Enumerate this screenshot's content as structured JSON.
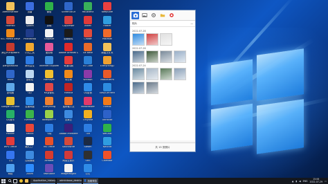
{
  "desktop": {
    "icons": [
      {
        "label": "Administrator",
        "color": "#f2c15a"
      },
      {
        "label": "Foxmail",
        "color": "#d84a3a"
      },
      {
        "label": "VLC media player",
        "color": "#f08a1a"
      },
      {
        "label": "跨云PDF转Word",
        "color": "#c63b2f"
      },
      {
        "label": "pangxiaocao",
        "color": "#4aa0e8"
      },
      {
        "label": "Word",
        "color": "#2f66c9"
      },
      {
        "label": "此电脑",
        "color": "#5fa8e8"
      },
      {
        "label": "Google Chrome",
        "color": "#e8c030"
      },
      {
        "label": "QQ音乐",
        "color": "#27b067"
      },
      {
        "label": "Pointer",
        "color": "#f5f5f5"
      },
      {
        "label": "WPS Office",
        "color": "#e23b3b"
      },
      {
        "label": "飞书",
        "color": "#3575f0"
      },
      {
        "label": "网络",
        "color": "#4ea0f0"
      },
      {
        "label": "迅雷",
        "color": "#3b6ddf"
      },
      {
        "label": "Typora",
        "color": "#eeeeee"
      },
      {
        "label": "Photoshop",
        "color": "#1f3c8a"
      },
      {
        "label": "小丸工具",
        "color": "#f0a830"
      },
      {
        "label": "腾讯会议",
        "color": "#2c7be5"
      },
      {
        "label": "回收站",
        "color": "#bcd7f2"
      },
      {
        "label": "QQ",
        "color": "#f3f3f3"
      },
      {
        "label": "百度网盘",
        "color": "#2f8be8"
      },
      {
        "label": "Evernote",
        "color": "#3bb54a"
      },
      {
        "label": "Xmind",
        "color": "#e8473a"
      },
      {
        "label": "格式工厂",
        "color": "#ffffff"
      },
      {
        "label": "控制面板",
        "color": "#3d8ae0"
      },
      {
        "label": "Zoom",
        "color": "#2d8cff"
      },
      {
        "label": "微信",
        "color": "#2fb24a"
      },
      {
        "label": "剪映",
        "color": "#111111"
      },
      {
        "label": "Snipaste",
        "color": "#f2f2f2"
      },
      {
        "label": "爱剪辑",
        "color": "#e55a9a"
      },
      {
        "label": "Internet Explorer",
        "color": "#3b8be0"
      },
      {
        "label": "PotPlayer",
        "color": "#f0c030"
      },
      {
        "label": "KK录像机",
        "color": "#e04848"
      },
      {
        "label": "Everything",
        "color": "#f08030"
      },
      {
        "label": "Notepad++",
        "color": "#9bd24a"
      },
      {
        "label": "卡顿",
        "color": "#2d7de2"
      },
      {
        "label": "MS Office",
        "color": "#e8502a"
      },
      {
        "label": "Acrobat",
        "color": "#d63b2f"
      },
      {
        "label": "FastStone",
        "color": "#6a4db8"
      },
      {
        "label": "ScreenToGif",
        "color": "#2f66c9"
      },
      {
        "label": "CAJViewer",
        "color": "#d84040"
      },
      {
        "label": "剪辑软件",
        "color": "#1b1b1b"
      },
      {
        "label": "Adobe Acrobat DC",
        "color": "#e02a2a"
      },
      {
        "label": "有道词典",
        "color": "#e63b3b"
      },
      {
        "label": "向日葵",
        "color": "#f08a1a"
      },
      {
        "label": "Filezilla",
        "color": "#c02424"
      },
      {
        "label": "搜狗输入法",
        "color": "#f0722a"
      },
      {
        "label": "坚果云",
        "color": "#3d8ae0"
      },
      {
        "label": "Adobe Premiere",
        "color": "#3a1f7a"
      },
      {
        "label": "SoundWire",
        "color": "#d34a3a"
      },
      {
        "label": "网易云音乐",
        "color": "#d23a3a"
      },
      {
        "label": "ImageMagick",
        "color": "#f3f3f3"
      },
      {
        "label": "HBuilderX",
        "color": "#38b05a"
      },
      {
        "label": "Xshell",
        "color": "#e03a3a"
      },
      {
        "label": "CMake",
        "color": "#e44b3b"
      },
      {
        "label": "Git Bash",
        "color": "#e86a2a"
      },
      {
        "label": "VS Code",
        "color": "#2a7fd6"
      },
      {
        "label": "WinRAR",
        "color": "#8a3aa8"
      },
      {
        "label": "QQ影音",
        "color": "#2f8be8"
      },
      {
        "label": "MindMaster",
        "color": "#e23a6a"
      },
      {
        "label": "Onlyone",
        "color": "#f2b020"
      },
      {
        "label": "TIM",
        "color": "#2d7de2"
      },
      {
        "label": "Steam",
        "color": "#1c2a44"
      },
      {
        "label": "OBS",
        "color": "#303030"
      },
      {
        "label": "钉钉",
        "color": "#2f8be8"
      },
      {
        "label": "KeepSafe",
        "color": "#e84040"
      },
      {
        "label": "Fiddler",
        "color": "#2f9de0"
      },
      {
        "label": "Postman",
        "color": "#f06a2a"
      },
      {
        "label": "新建文件夹",
        "color": "#f2c15a"
      },
      {
        "label": "Everything2",
        "color": "#f0a030"
      },
      {
        "label": "MobaXterm",
        "color": "#e85a2a"
      },
      {
        "label": "EasyConnect",
        "color": "#2d8ce0"
      },
      {
        "label": "Firefox",
        "color": "#f07a1a"
      },
      {
        "label": "UltraEdit",
        "color": "#2d62c9"
      },
      {
        "label": "WeChat",
        "color": "#2fb24a"
      },
      {
        "label": "Navicat",
        "color": "#2f9de0"
      },
      {
        "label": "Calendar",
        "color": "#f0522a"
      }
    ]
  },
  "window": {
    "toolbar_buttons": [
      {
        "name": "camera-icon",
        "active": true
      },
      {
        "name": "image-icon",
        "active": false
      },
      {
        "name": "gear-icon",
        "active": false
      },
      {
        "name": "folder-icon",
        "active": false
      },
      {
        "name": "record-icon",
        "active": false
      }
    ],
    "sub_left": "相片",
    "sub_right": "—",
    "groups": [
      {
        "date": "2022-07-28",
        "thumbs": [
          "#2f8be0",
          "#d04040",
          "#e0e0e0"
        ]
      },
      {
        "date": "2022-07-26",
        "thumbs": [
          "#4a6a8a",
          "#3f5a3a",
          "#7a8a9a",
          "#9ab0c8"
        ]
      },
      {
        "date": "2022-07-24",
        "thumbs": [
          "#6a8aa0",
          "#a8b8c8",
          "#5a7a5a",
          "#8aa0b8"
        ]
      },
      {
        "date": "",
        "thumbs": [
          "#4a6a8a",
          "#6a7a8a"
        ]
      }
    ],
    "footer": "共 15 张照片"
  },
  "taskbar": {
    "tasks": [
      {
        "label": "Application_history...",
        "color": "#3bb54a",
        "active": false
      },
      {
        "label": "adminbase_desktop...",
        "color": "#4a8ae0",
        "active": false
      },
      {
        "label": "拍照预览",
        "color": "#2b6fd6",
        "active": true
      }
    ],
    "tray_text": "ENG",
    "time": "15:06",
    "date": "2022-07-29"
  }
}
